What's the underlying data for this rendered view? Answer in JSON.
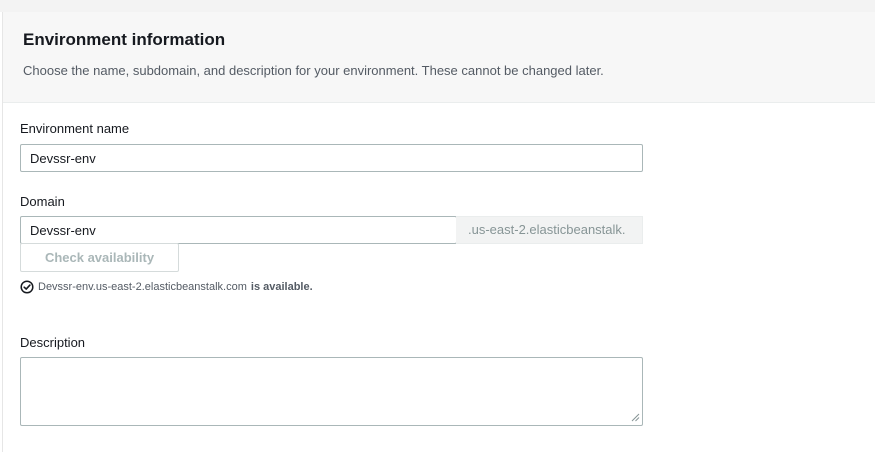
{
  "section": {
    "title": "Environment information",
    "description": "Choose the name, subdomain, and description for your environment. These cannot be changed later."
  },
  "env_name": {
    "label": "Environment name",
    "value": "Devssr-env"
  },
  "domain": {
    "label": "Domain",
    "value": "Devssr-env",
    "suffix": ".us-east-2.elasticbeanstalk."
  },
  "check_button": {
    "label": "Check availability"
  },
  "availability": {
    "url": "Devssr-env.us-east-2.elasticbeanstalk.com",
    "status": "is available.",
    "icon": "check-circle-icon"
  },
  "description_field": {
    "label": "Description",
    "value": ""
  },
  "colors": {
    "header_bg": "#f7f7f7",
    "input_border": "#aab7b8",
    "text": "#16191f",
    "muted": "#545b64"
  }
}
